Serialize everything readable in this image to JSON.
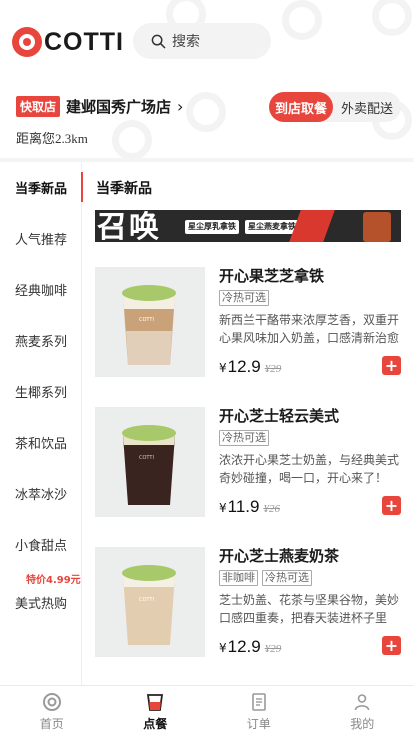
{
  "brand": {
    "logo_text": "COTTI",
    "accent": "#e8453c"
  },
  "search": {
    "placeholder": "搜索"
  },
  "store": {
    "badge": "快取店",
    "name": "建邺国秀广场店",
    "distance": "距离您2.3km"
  },
  "order_mode": {
    "active": "到店取餐",
    "inactive": "外卖配送"
  },
  "sidebar": {
    "categories": [
      {
        "label": "当季新品",
        "active": true
      },
      {
        "label": "人气推荐"
      },
      {
        "label": "经典咖啡"
      },
      {
        "label": "燕麦系列"
      },
      {
        "label": "生椰系列"
      },
      {
        "label": "茶和饮品"
      },
      {
        "label": "冰萃冰沙"
      },
      {
        "label": "小食甜点"
      },
      {
        "label": "美式热购"
      }
    ],
    "promo_badge": "特价4.99元"
  },
  "main": {
    "section_title": "当季新品",
    "banner": {
      "big_text": "召唤",
      "pills": [
        "星尘厚乳拿铁",
        "星尘燕麦拿铁"
      ]
    },
    "products": [
      {
        "name": "开心果芝芝拿铁",
        "tags": [
          "冷热可选"
        ],
        "desc": "新西兰干酪带来浓厚芝香，双重开心果风味加入奶盖，口感清新治愈",
        "currency": "¥",
        "price": "12.9",
        "old_price": "¥29",
        "cup_body": "#c9a27a"
      },
      {
        "name": "开心芝士轻云美式",
        "tags": [
          "冷热可选"
        ],
        "desc": "浓浓开心果芝士奶盖，与经典美式奇妙碰撞，喝一口，开心来了！",
        "currency": "¥",
        "price": "11.9",
        "old_price": "¥26",
        "cup_body": "#3a2420"
      },
      {
        "name": "开心芝士燕麦奶茶",
        "tags": [
          "非咖啡",
          "冷热可选"
        ],
        "desc": "芝士奶盖、花茶与坚果谷物，美妙口感四重奏，把春天装进杯子里",
        "currency": "¥",
        "price": "12.9",
        "old_price": "¥29",
        "cup_body": "#e3cdb0"
      }
    ]
  },
  "tabbar": {
    "items": [
      {
        "label": "首页",
        "icon": "home-logo-icon"
      },
      {
        "label": "点餐",
        "icon": "cup-icon",
        "active": true
      },
      {
        "label": "订单",
        "icon": "order-list-icon"
      },
      {
        "label": "我的",
        "icon": "profile-icon"
      }
    ]
  }
}
